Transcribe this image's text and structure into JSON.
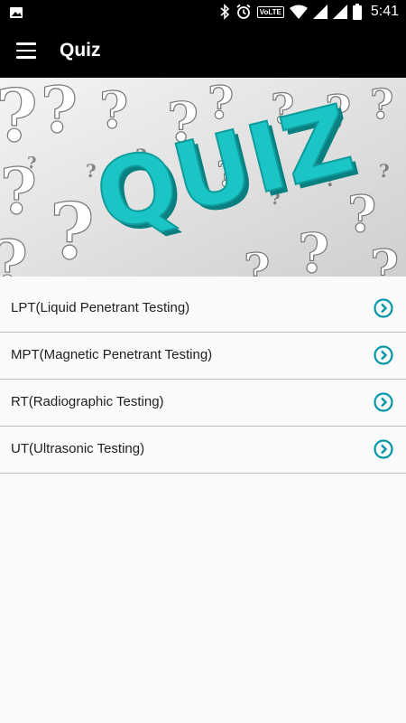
{
  "status_bar": {
    "time": "5:41",
    "network_badge": "VoLTE",
    "icons": [
      "image-icon",
      "bluetooth-icon",
      "alarm-icon",
      "volte-icon",
      "wifi-icon",
      "signal-icon",
      "signal-icon",
      "battery-icon"
    ]
  },
  "app_bar": {
    "title": "Quiz",
    "menu_icon": "hamburger-menu-icon"
  },
  "banner": {
    "text": "QUIZ",
    "accent_color": "#1bc5c5"
  },
  "quiz_list": {
    "items": [
      {
        "label": "LPT(Liquid Penetrant Testing)",
        "icon": "chevron-right-circle-icon"
      },
      {
        "label": "MPT(Magnetic Penetrant Testing)",
        "icon": "chevron-right-circle-icon"
      },
      {
        "label": "RT(Radiographic Testing)",
        "icon": "chevron-right-circle-icon"
      },
      {
        "label": "UT(Ultrasonic Testing)",
        "icon": "chevron-right-circle-icon"
      }
    ],
    "chevron_color": "#0097a7"
  }
}
